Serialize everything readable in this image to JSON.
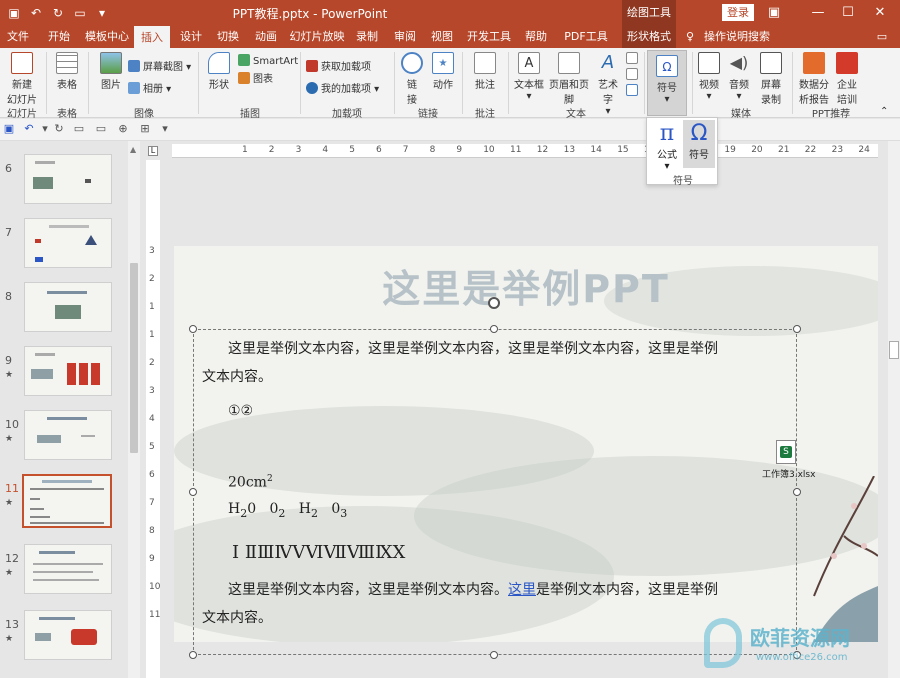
{
  "titlebar": {
    "doc_title": "PPT教程.pptx  -  PowerPoint",
    "context_header": "绘图工具",
    "login": "登录",
    "colors": {
      "accent": "#b7472a",
      "context": "#8f3720"
    }
  },
  "tabs": [
    "文件",
    "开始",
    "模板中心",
    "插入",
    "设计",
    "切换",
    "动画",
    "幻灯片放映",
    "录制",
    "审阅",
    "视图",
    "开发工具",
    "帮助",
    "PDF工具集",
    "形状格式"
  ],
  "tab_active": "插入",
  "tellme": "操作说明搜索",
  "ribbon": {
    "new_slide": "新建\n幻灯片",
    "table": "表格",
    "picture": "图片",
    "screenshot": "屏幕截图",
    "album": "相册",
    "shapes": "形状",
    "smartart": "SmartArt",
    "chart": "图表",
    "get_addins": "获取加载项",
    "my_addins": "我的加载项",
    "link": "链\n接",
    "action": "动作",
    "comment": "批注",
    "textbox": "文本框",
    "header_footer": "页眉和页脚",
    "wordart": "艺术字",
    "symbol": "符号",
    "video": "视频",
    "audio": "音频",
    "screen_record": "屏幕\n录制",
    "data_analysis": "数据分\n析报告",
    "enterprise": "企业\n培训",
    "groups": {
      "slides": "幻灯片",
      "tables": "表格",
      "images": "图像",
      "illustrations": "插图",
      "addins": "加载项",
      "links": "链接",
      "comments": "批注",
      "text": "文本",
      "media": "媒体",
      "ppt_recommend": "PPT推荐"
    }
  },
  "symbol_dropdown": {
    "formula": "公式",
    "symbol": "符号",
    "group": "符号"
  },
  "ruler": {
    "h_ticks": [
      "1",
      "2",
      "3",
      "4",
      "5",
      "6",
      "7",
      "8",
      "9",
      "10",
      "11",
      "12",
      "13",
      "14",
      "15",
      "16",
      "17",
      "18",
      "19",
      "20",
      "21",
      "22",
      "23",
      "24"
    ],
    "v_ticks": [
      "3",
      "2",
      "1",
      "1",
      "2",
      "3",
      "4",
      "5",
      "6",
      "7",
      "8",
      "9",
      "10",
      "11"
    ]
  },
  "thumbnails": [
    {
      "num": "6",
      "star": "",
      "selected": false
    },
    {
      "num": "7",
      "star": "",
      "selected": false
    },
    {
      "num": "8",
      "star": "",
      "selected": false
    },
    {
      "num": "9",
      "star": "★",
      "selected": false
    },
    {
      "num": "10",
      "star": "★",
      "selected": false
    },
    {
      "num": "11",
      "star": "★",
      "selected": true
    },
    {
      "num": "12",
      "star": "★",
      "selected": false
    },
    {
      "num": "13",
      "star": "★",
      "selected": false
    }
  ],
  "slide": {
    "title": "这里是举例PPT",
    "para1_line1": "这里是举例文本内容，这里是举例文本内容，这里是举例文本内容，这里是举例",
    "para1_line2": "文本内容。",
    "circled": "①②",
    "area_base": "20cm",
    "area_sup": "2",
    "chem_h2o_h": "H",
    "chem_h2o_sub": "2",
    "chem_h2o_o": "0",
    "chem_o2_o": "0",
    "chem_o2_sub": "2",
    "chem_h2_h": "H",
    "chem_h2_sub": "2",
    "chem_o3_o": "0",
    "chem_o3_sub": "3",
    "roman": "Ⅰ ⅡⅢⅣⅤⅥⅦⅧⅨⅩ",
    "para2_a": "这里是举例文本内容，这里是举例文本内容。",
    "para2_link": "这里",
    "para2_b": "是举例文本内容，这里是举例",
    "para2_line2": "文本内容。",
    "xls_label": "工作簿3.xlsx"
  },
  "watermark": {
    "text1": "欧菲资源网",
    "text2": "www.office26.com"
  }
}
